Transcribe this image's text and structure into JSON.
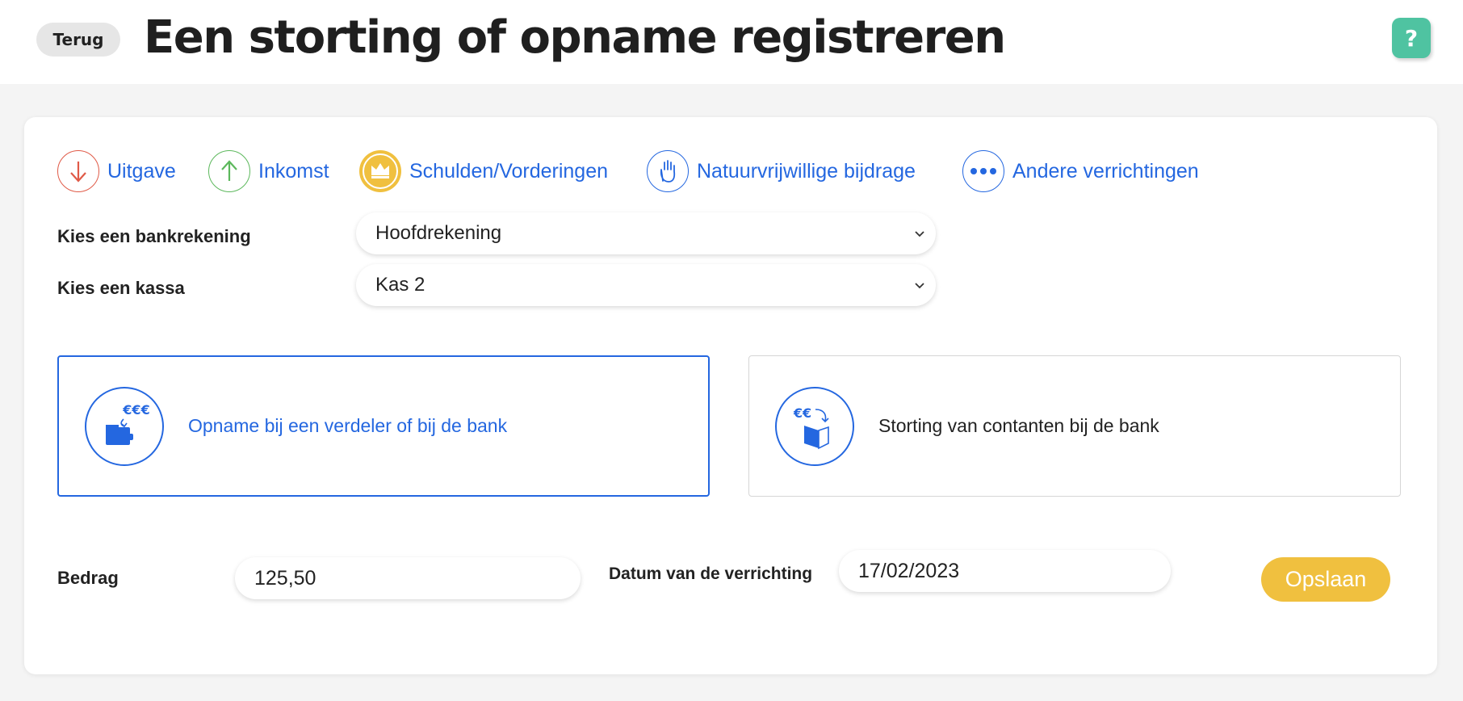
{
  "header": {
    "back_label": "Terug",
    "title": "Een storting of opname registreren",
    "help_label": "?"
  },
  "tabs": [
    {
      "label": "Uitgave",
      "icon": "arrow-down-icon",
      "color": "#e05a47"
    },
    {
      "label": "Inkomst",
      "icon": "arrow-up-icon",
      "color": "#5cb85c"
    },
    {
      "label": "Schulden/Vorderingen",
      "icon": "crown-icon",
      "color": "#f0c03f"
    },
    {
      "label": "Natuurvrijwillige bijdrage",
      "icon": "hand-icon",
      "color": "#2467e0"
    },
    {
      "label": "Andere verrichtingen",
      "icon": "more-dots-icon",
      "color": "#2467e0"
    }
  ],
  "form": {
    "bank_label": "Kies een bankrekening",
    "bank_value": "Hoofdrekening",
    "cash_label": "Kies een kassa",
    "cash_value": "Kas 2",
    "amount_label": "Bedrag",
    "amount_value": "125,50",
    "date_label": "Datum van de verrichting",
    "date_value": "17/02/2023",
    "save_label": "Opslaan"
  },
  "options": [
    {
      "label": "Opname bij een verdeler of bij de bank",
      "icon": "wallet-euro-icon",
      "selected": true,
      "icon_text": "€€€"
    },
    {
      "label": "Storting van contanten bij de bank",
      "icon": "deposit-euro-icon",
      "selected": false,
      "icon_text": "€€"
    }
  ],
  "colors": {
    "accent": "#2467e0",
    "save": "#f0c03f",
    "help": "#4fc3a1"
  }
}
